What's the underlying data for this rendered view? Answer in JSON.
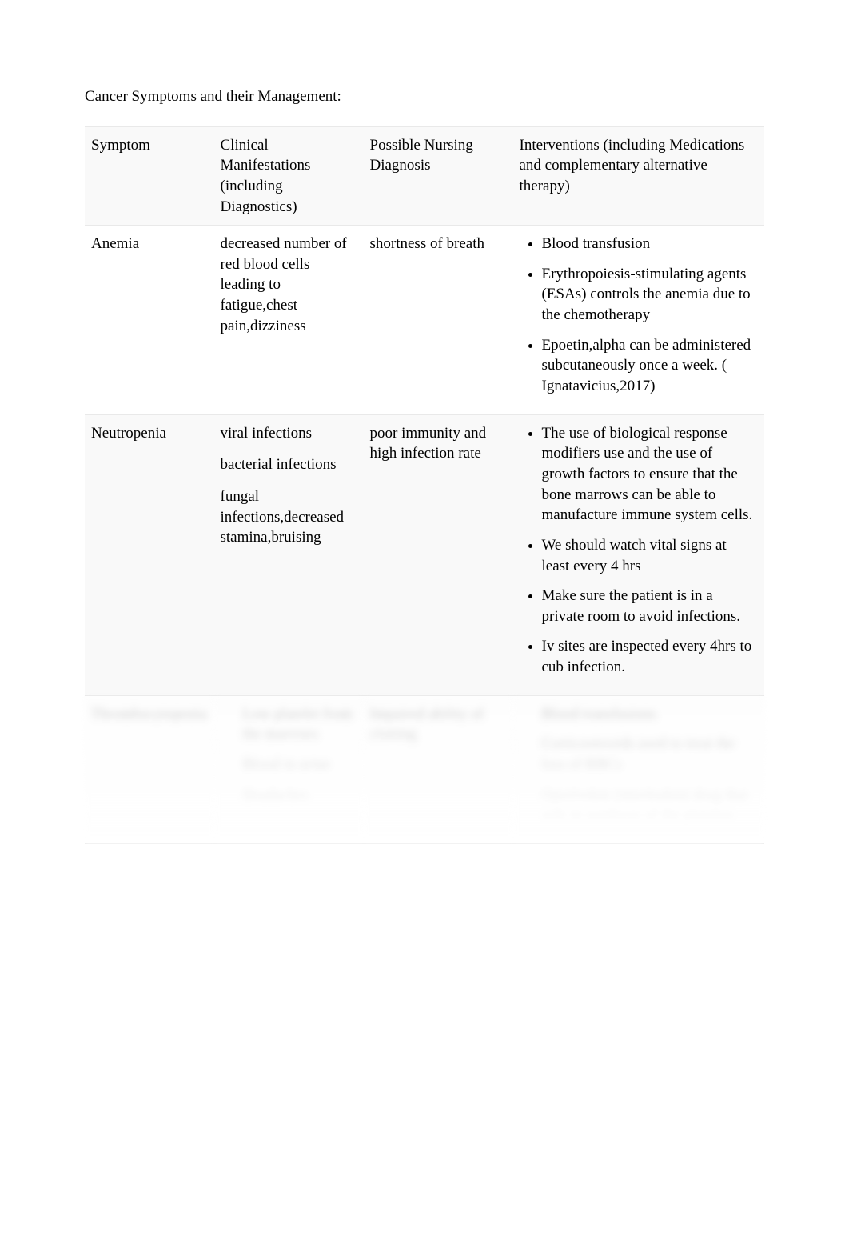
{
  "title": "Cancer Symptoms and their Management:",
  "headers": {
    "symptom": "Symptom",
    "manifestations": "Clinical Manifestations (including Diagnostics)",
    "diagnosis": "Possible Nursing Diagnosis",
    "interventions": "Interventions (including Medications and complementary alternative therapy)"
  },
  "rows": {
    "anemia": {
      "symptom": "Anemia",
      "manifestations": "decreased number of red blood cells leading to fatigue,chest pain,dizziness",
      "diagnosis": "shortness of breath",
      "interventions": [
        "Blood transfusion",
        "Erythropoiesis-stimulating agents (ESAs) controls the anemia due to the chemotherapy",
        "Epoetin,alpha can be administered subcutaneously once a week. (   Ignatavicius,2017)"
      ]
    },
    "neutropenia": {
      "symptom": "Neutropenia",
      "manifestations": {
        "p1": "viral infections",
        "p2": "bacterial infections",
        "p3": "fungal infections,decreased stamina,bruising"
      },
      "diagnosis": "poor immunity and high infection rate",
      "interventions": [
        "The use of biological response modifiers use and the use of growth factors to ensure that the bone marrows can be able to manufacture immune system cells.",
        "We should watch vital signs at least every 4 hrs",
        "Make sure the patient is in a private room to avoid infections.",
        "Iv sites are inspected every 4hrs  to cub infection."
      ]
    },
    "thrombocytopenia": {
      "symptom": "Thrombocytopenia",
      "manifestations": [
        "Low platelet from the marrows",
        "Blood in urine",
        "Headaches"
      ],
      "diagnosis": "Impaired ability of clotting",
      "interventions": [
        "Blood transfusions",
        "Corticosteroids used to treat the loss of RBCs",
        "Oprelvekin (interleukin) drug that aids in synthesis of the platelets"
      ]
    }
  }
}
